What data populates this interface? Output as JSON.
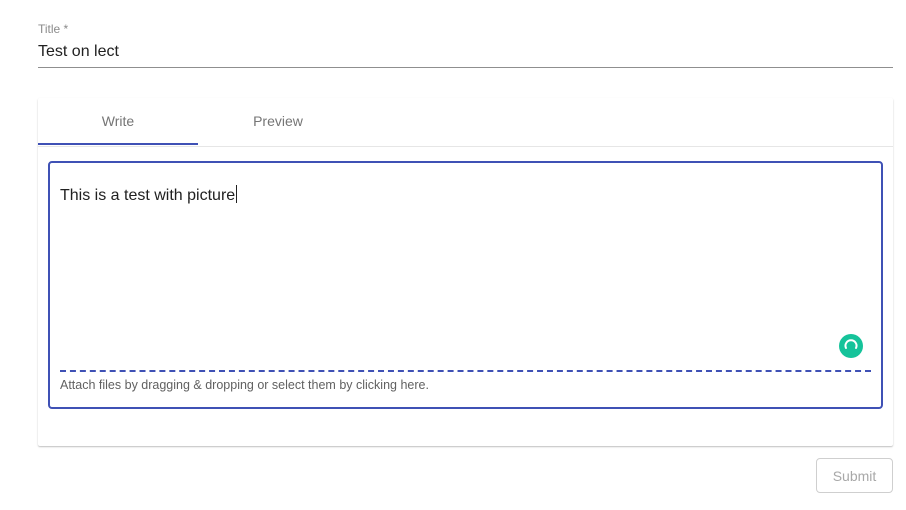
{
  "title_field": {
    "label": "Title *",
    "value": "Test on lect"
  },
  "tabs": [
    {
      "label": "Write",
      "active": true
    },
    {
      "label": "Preview",
      "active": false
    }
  ],
  "editor": {
    "text": "This is a test with picture",
    "attach_hint": "Attach files by dragging & dropping or select them by clicking here.",
    "grammar_icon": "grammarly-icon"
  },
  "actions": {
    "submit_label": "Submit"
  },
  "colors": {
    "accent": "#3f51b5",
    "grammar": "#15c39a"
  }
}
